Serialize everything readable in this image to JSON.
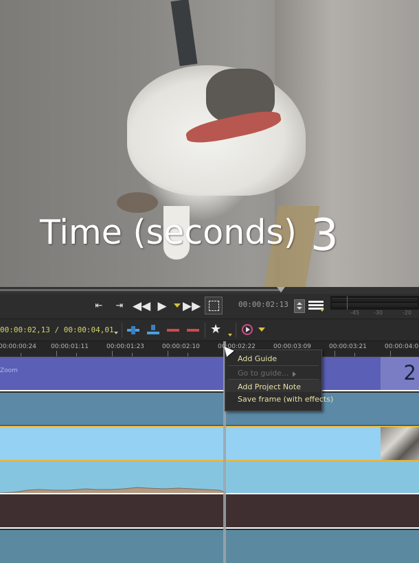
{
  "preview": {
    "overlay_title": "Time (seconds)",
    "overlay_number": "3"
  },
  "transport": {
    "timecode": "00:00:02:13",
    "meter_labels": [
      "-45",
      "-30",
      "-20"
    ],
    "icons": [
      "set-in-point-icon",
      "set-out-point-icon",
      "rewind-icon",
      "play-icon",
      "fast-forward-icon",
      "fullscreen-icon",
      "menu-icon"
    ]
  },
  "timeline_toolbar": {
    "position": "00:00:02,13 / 00:00:04,01"
  },
  "ruler": {
    "labels": [
      "00:00:00:24",
      "00:00:01:11",
      "00:00:01:23",
      "00:00:02:10",
      "00:00:02:22",
      "00:00:03:09",
      "00:00:03:21",
      "00:00:04:0"
    ]
  },
  "tracks": {
    "track1_label": "Zoom",
    "track1_number": "2"
  },
  "context_menu": {
    "items": [
      {
        "label": "Add Guide",
        "enabled": true
      },
      {
        "label": "Go to guide...",
        "enabled": false
      },
      {
        "label": "Add Project Note",
        "enabled": true
      },
      {
        "label": "Save frame (with effects)",
        "enabled": true
      }
    ]
  },
  "colors": {
    "accent_yellow": "#d8c23a",
    "track_blue": "#5b5fb5",
    "track_clip": "#95d1f3",
    "track_dark": "#402f31"
  }
}
